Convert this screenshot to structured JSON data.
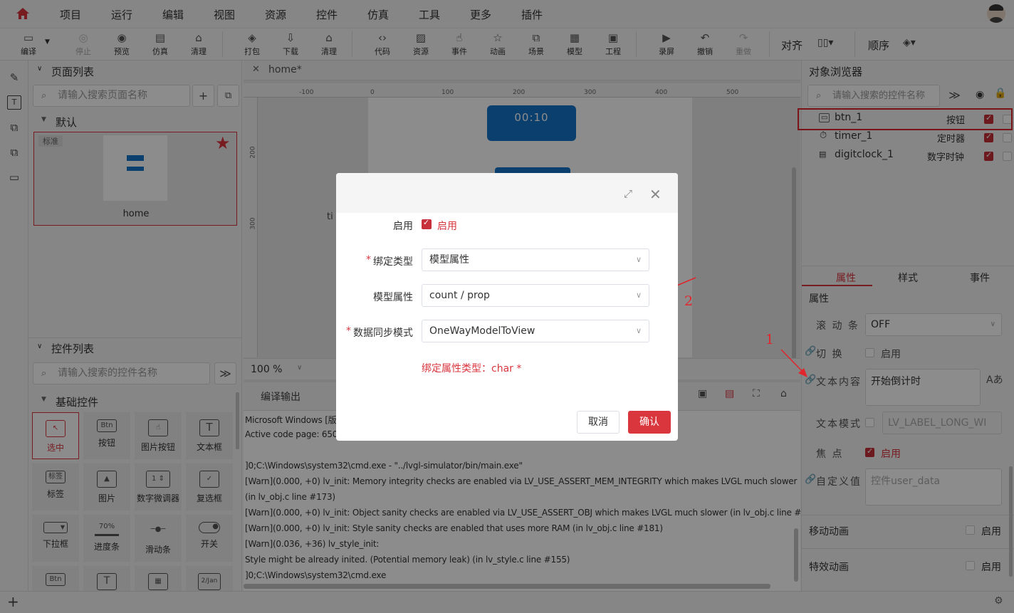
{
  "menu": {
    "items": [
      "项目",
      "运行",
      "编辑",
      "视图",
      "资源",
      "控件",
      "仿真",
      "工具",
      "更多",
      "插件"
    ]
  },
  "toolbar": {
    "tools": [
      "编译",
      "停止",
      "预览",
      "仿真",
      "清理",
      "打包",
      "下载",
      "清理",
      "代码",
      "资源",
      "事件",
      "动画",
      "场景",
      "模型",
      "工程",
      "录屏",
      "撤销",
      "重做"
    ],
    "align_label": "对齐",
    "order_label": "顺序"
  },
  "page_panel": {
    "title": "页面列表",
    "search_placeholder": "请输入搜索页面名称",
    "group": "默认",
    "page_badge": "标准",
    "page_name": "home"
  },
  "widget_panel": {
    "title": "控件列表",
    "search_placeholder": "请输入搜索的控件名称",
    "group": "基础控件",
    "widgets": [
      "选中",
      "按钮",
      "图片按钮",
      "文本框",
      "标签",
      "图片",
      "数字微调器",
      "复选框",
      "下拉框",
      "进度条",
      "滑动条",
      "开关"
    ],
    "icon_texts": {
      "button": "Btn",
      "label": "标签",
      "progress": "70%"
    }
  },
  "editor": {
    "tab": "home*",
    "ruler_marks": [
      "-100",
      "0",
      "100",
      "200",
      "300",
      "400",
      "500"
    ],
    "v_ruler_marks": [
      "200",
      "300"
    ],
    "timer_text": "00:10",
    "partial_label": "ti",
    "zoom": "100 %",
    "output_tab": "编译输出"
  },
  "console": {
    "lines": [
      "Microsoft Windows [版本",
      "Active code page: 65001",
      "",
      "]0;C:\\Windows\\system32\\cmd.exe - \"../lvgl-simulator/bin/main.exe\"",
      "[Warn](0.000, +0) lv_init: Memory integrity checks are enabled via LV_USE_ASSERT_MEM_INTEGRITY which makes LVGL much slower",
      " (in lv_obj.c line #173)",
      "[Warn](0.000, +0) lv_init: Object sanity checks are enabled via LV_USE_ASSERT_OBJ which makes LVGL much slower (in lv_obj.c line #177)",
      "[Warn](0.000, +0) lv_init: Style sanity checks are enabled that uses more RAM (in lv_obj.c line #181)",
      "[Warn](0.036, +36) lv_style_init:",
      "Style might be already inited. (Potential memory leak) (in lv_style.c line #155)",
      "]0;C:\\Windows\\system32\\cmd.exe"
    ]
  },
  "object_browser": {
    "title": "对象浏览器",
    "search_placeholder": "请输入搜索的控件名称",
    "objects": [
      {
        "name": "btn_1",
        "type": "按钮"
      },
      {
        "name": "timer_1",
        "type": "定时器"
      },
      {
        "name": "digitclock_1",
        "type": "数字时钟"
      }
    ]
  },
  "properties": {
    "tabs": [
      "属性",
      "样式",
      "事件"
    ],
    "section": "属性",
    "scrollbar_label": "滚 动 条",
    "scrollbar_value": "OFF",
    "switch_label": "切  换",
    "enable": "启用",
    "text_label": "文本内容",
    "text_value": "开始倒计时",
    "mode_label": "文本模式",
    "mode_value": "LV_LABEL_LONG_WI",
    "focus_label": "焦   点",
    "userdata_label": "自定义值",
    "userdata_placeholder": "控件user_data",
    "move_anim": "移动动画",
    "effect_anim": "特效动画"
  },
  "annotations": {
    "one": "1",
    "two": "2",
    "color": "#e0262c"
  },
  "dialog": {
    "enable_label": "启用",
    "enable_check_label": "启用",
    "bind_type_label": "绑定类型",
    "bind_type_value": "模型属性",
    "model_prop_label": "模型属性",
    "model_prop_value": "count / prop",
    "sync_label": "数据同步模式",
    "sync_value": "OneWayModelToView",
    "hint": "绑定属性类型：char *",
    "cancel": "取消",
    "confirm": "确认"
  },
  "colors": {
    "accent": "#d9363e",
    "blue": "#1476c9"
  }
}
